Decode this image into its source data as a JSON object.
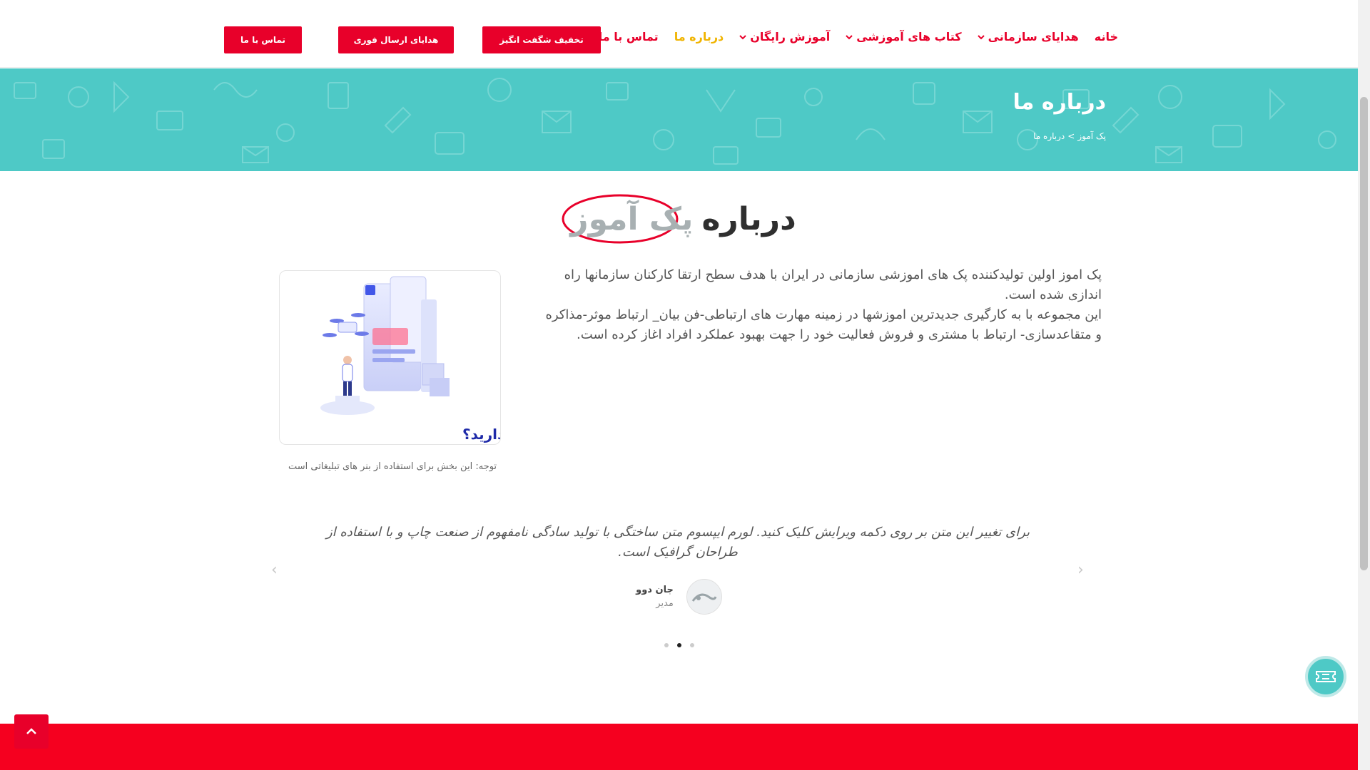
{
  "nav": {
    "items": [
      {
        "label": "خانه",
        "dropdown": false,
        "active": false
      },
      {
        "label": "هدایای سازمانی",
        "dropdown": true,
        "active": false
      },
      {
        "label": "کتاب های آموزشی",
        "dropdown": true,
        "active": false
      },
      {
        "label": "آموزش رایگان",
        "dropdown": true,
        "active": false
      },
      {
        "label": "درباره ما",
        "dropdown": false,
        "active": true
      },
      {
        "label": "تماس با ما",
        "dropdown": false,
        "active": false
      }
    ],
    "buttons": {
      "discount": "تخفیف شگفت انگیز",
      "instant_gifts": "هدایای ارسال فوری",
      "contact": "تماس با ما"
    }
  },
  "banner": {
    "title": "درباره ما",
    "breadcrumb_home": "پک آموز",
    "breadcrumb_sep": ">",
    "breadcrumb_current": "درباره ما"
  },
  "about": {
    "heading_prefix": "درباره",
    "heading_brand": "پک آموز",
    "paragraph_1": "پک اموز اولین تولیدکننده پک های اموزشی سازمانی در ایران با هدف سطح ارتقا کارکنان سازمانها راه اندازی شده است.",
    "paragraph_2": "این مجموعه با به کارگیری جدیدترین اموزشها در زمینه مهارت های ارتباطی-فن بیان_ ارتباط موثر-مذاکره و متقاعدسازی- ارتباط با مشتری و فروش فعالیت خود را جهت بهبود عملکرد افراد اغاز کرده است."
  },
  "promo": {
    "banner_text": "به پشتیبانی نیاز دارید؟",
    "caption": "توجه: این بخش برای استفاده از بنر های تبلیغاتی است"
  },
  "testimonial": {
    "quote": "برای تغییر این متن بر روی دکمه ویرایش کلیک کنید. لورم ایپسوم متن ساختگی با تولید سادگی نامفهوم از صنعت چاپ و با استفاده از طراحان گرافیک است.",
    "author_name": "جان دوو",
    "author_role": "مدیر",
    "prev_arrow": "‹",
    "next_arrow": "›",
    "slides": 3,
    "active_slide": 2
  },
  "scroll_top_icon": "chevron-up-icon",
  "ticket_icon": "ticket-icon",
  "colors": {
    "primary": "#e8002a",
    "active_nav": "#f0b400",
    "banner_bg": "#4ec9c6",
    "footer": "#f5001f"
  }
}
